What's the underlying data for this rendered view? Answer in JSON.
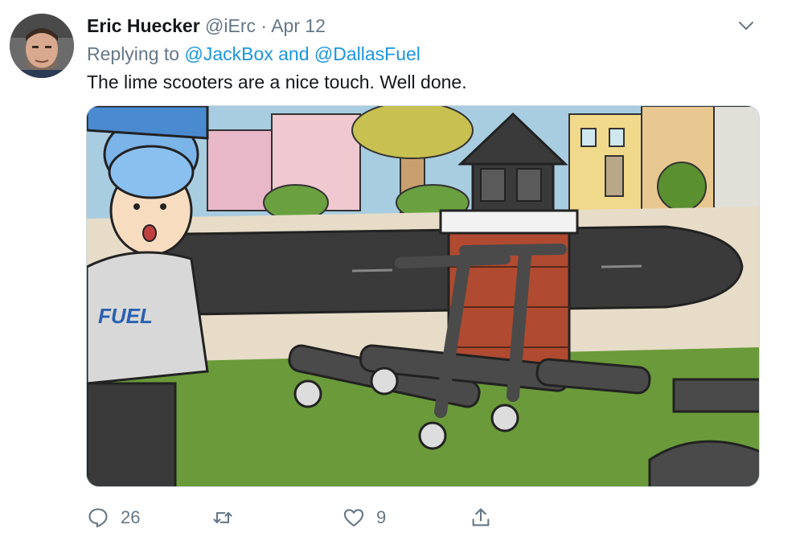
{
  "tweet": {
    "author_name": "Eric Huecker",
    "handle": "@iErc",
    "separator": "·",
    "date": "Apr 12",
    "reply_prefix": "Replying to",
    "reply_mention_1": "@JackBox",
    "reply_and": "and",
    "reply_mention_2": "@DallasFuel",
    "text": "The lime scooters are a nice touch. Well done."
  },
  "media": {
    "hoodie_text": "FUEL"
  },
  "actions": {
    "reply_count": "26",
    "retweet_count": "",
    "like_count": "9"
  },
  "colors": {
    "link": "#1b95e0",
    "secondary_text": "#657786",
    "primary_text": "#14171a"
  },
  "icons": [
    "avatar",
    "chevron-down-icon",
    "reply-icon",
    "retweet-icon",
    "like-icon",
    "share-icon"
  ]
}
